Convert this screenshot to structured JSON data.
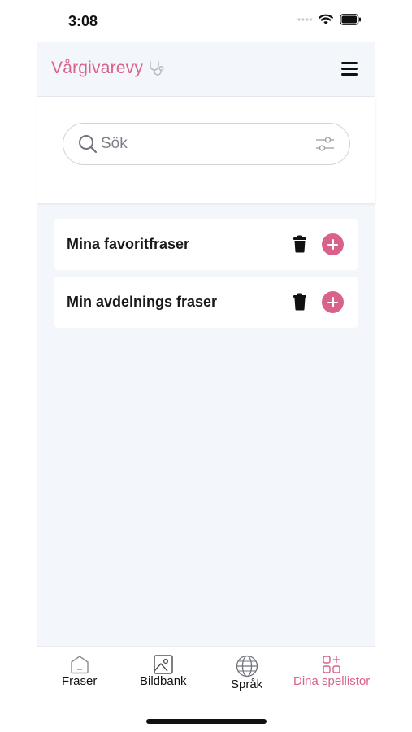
{
  "status_bar": {
    "time": "3:08"
  },
  "header": {
    "title": "Vårgivarevy",
    "title_icon": "stethoscope-icon",
    "menu_icon": "hamburger-menu-icon"
  },
  "search": {
    "placeholder": "Sök",
    "value": ""
  },
  "playlists": [
    {
      "label": "Mina favoritfraser"
    },
    {
      "label": "Min avdelnings fraser"
    }
  ],
  "tabs": [
    {
      "label": "Fraser",
      "icon": "home-icon",
      "active": false
    },
    {
      "label": "Bildbank",
      "icon": "image-icon",
      "active": false
    },
    {
      "label": "Språk",
      "icon": "globe-icon",
      "active": false
    },
    {
      "label": "Dina spellistor",
      "icon": "playlist-grid-icon",
      "active": true
    }
  ],
  "colors": {
    "accent": "#d9628a",
    "background": "#f3f6fb"
  }
}
